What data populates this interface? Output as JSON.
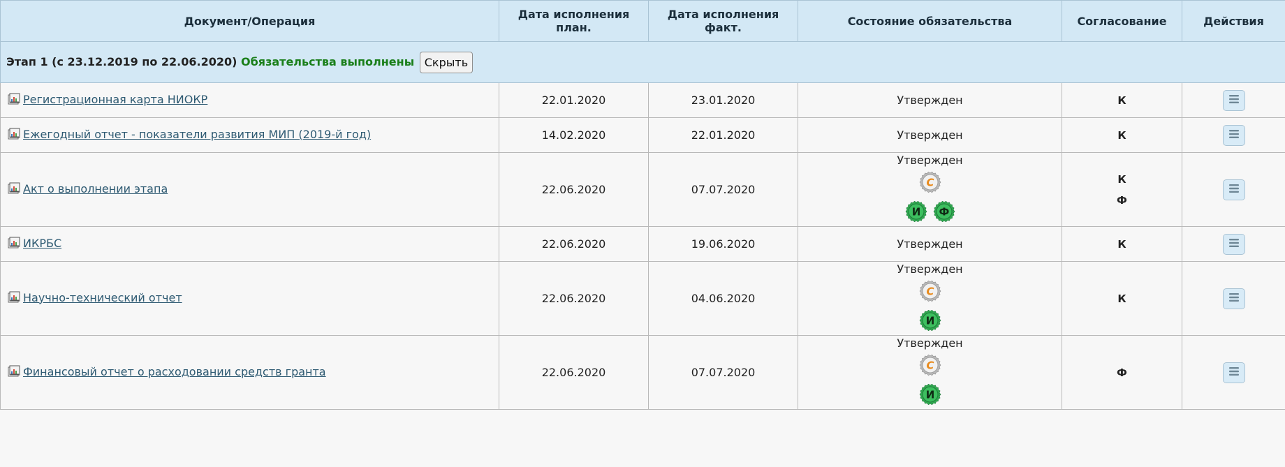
{
  "table": {
    "headers": [
      "Документ/Операция",
      "Дата исполнения план.",
      "Дата исполнения факт.",
      "Состояние обязательства",
      "Согласование",
      "Действия"
    ]
  },
  "stage": {
    "title": "Этап 1 (с 23.12.2019 по 22.06.2020)",
    "status": "Обязательства выполнены",
    "hide_label": "Скрыть"
  },
  "rows": [
    {
      "doc": "Регистрационная карта НИОКР",
      "plan": "22.01.2020",
      "fact": "23.01.2020",
      "state": "Утвержден",
      "agree": [
        "К"
      ]
    },
    {
      "doc": "Ежегодный отчет - показатели развития МИП (2019-й год)",
      "plan": "14.02.2020",
      "fact": "22.01.2020",
      "state": "Утвержден",
      "agree": [
        "К"
      ]
    },
    {
      "doc": "Акт о выполнении этапа",
      "plan": "22.06.2020",
      "fact": "07.07.2020",
      "state": "Утвержден",
      "stamp_letters": [
        "С",
        "И",
        "Ф"
      ],
      "agree": [
        "К",
        "Ф"
      ]
    },
    {
      "doc": "ИКРБС",
      "plan": "22.06.2020",
      "fact": "19.06.2020",
      "state": "Утвержден",
      "agree": [
        "К"
      ]
    },
    {
      "doc": "Научно-технический отчет",
      "plan": "22.06.2020",
      "fact": "04.06.2020",
      "state": "Утвержден",
      "stamp_letters": [
        "С",
        "И"
      ],
      "agree": [
        "К"
      ]
    },
    {
      "doc": "Финансовый отчет о расходовании средств гранта",
      "plan": "22.06.2020",
      "fact": "07.07.2020",
      "state": "Утвержден",
      "stamp_letters": [
        "С",
        "И"
      ],
      "agree": [
        "Ф"
      ]
    }
  ],
  "icons": {
    "document": "document-chart-icon",
    "menu": "hamburger-menu-icon",
    "stamp_s": "silver-seal-s-icon",
    "stamp_green": "green-seal-icon"
  },
  "colors": {
    "header_bg": "#d3e8f5",
    "stage_ok": "#1a7f1a",
    "link": "#2e5a72",
    "seal_green": "#2fa84f",
    "seal_letter_orange": "#e8891a"
  }
}
